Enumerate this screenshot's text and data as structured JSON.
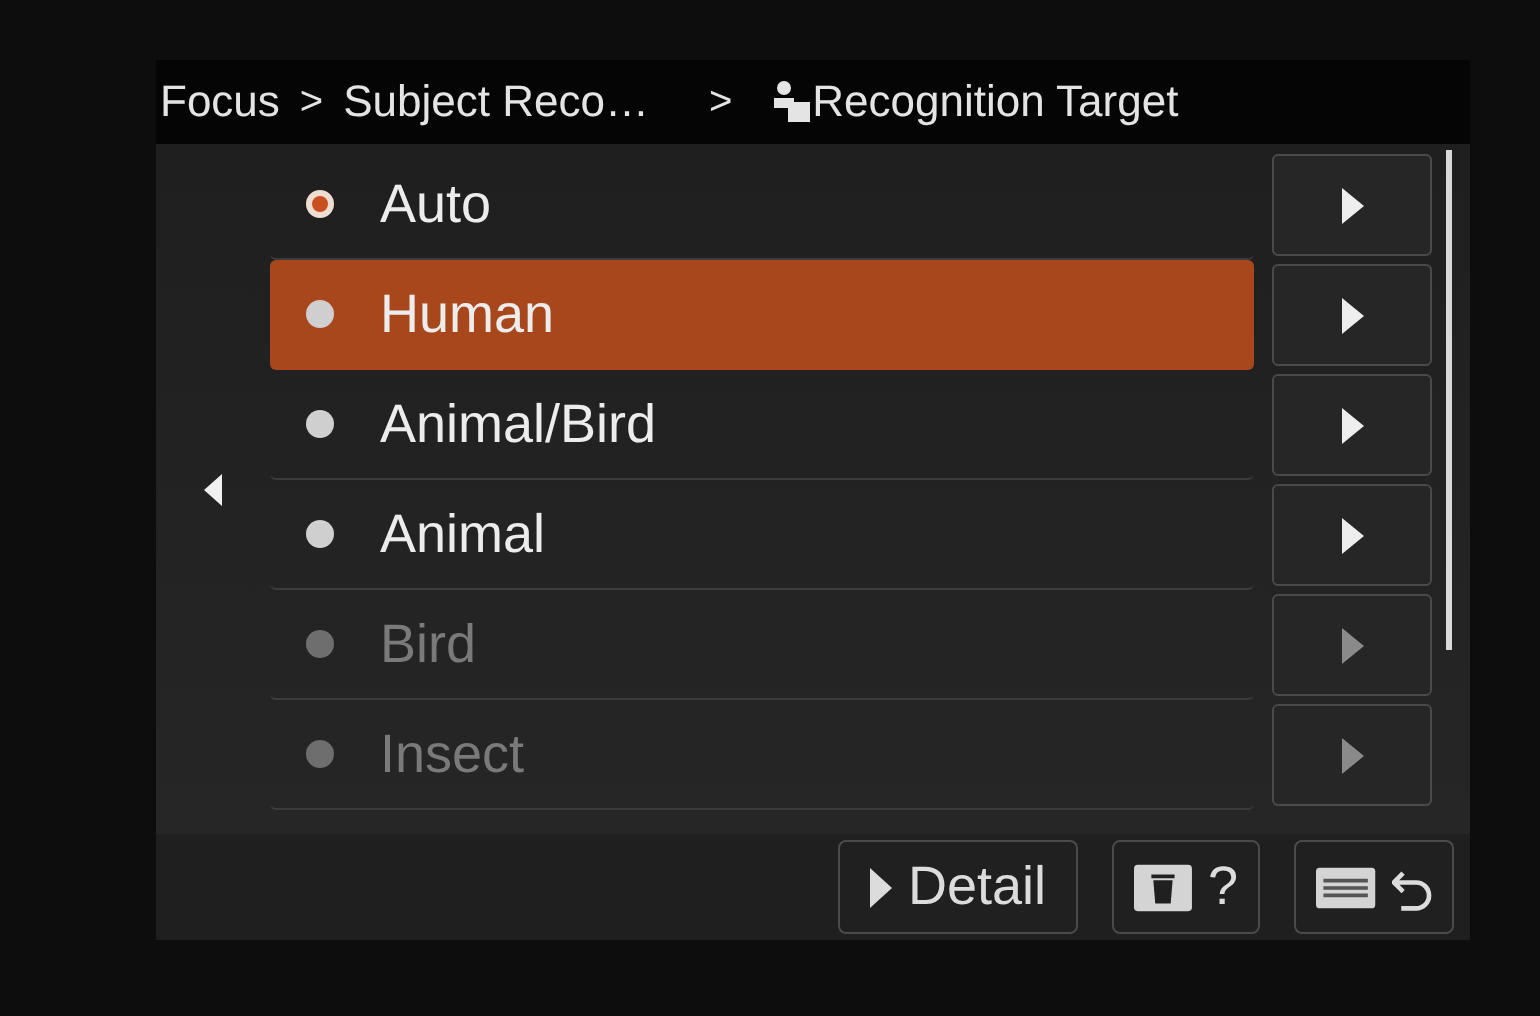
{
  "breadcrumb": [
    {
      "kind": "crumb",
      "text": "Focus"
    },
    {
      "kind": "separator",
      "text": ">"
    },
    {
      "kind": "crumb",
      "text": "Subject Reco…"
    },
    {
      "kind": "separator",
      "text": ">"
    },
    {
      "kind": "current",
      "text": "Recognition Target"
    }
  ],
  "options": [
    {
      "label": "Auto",
      "checked": true,
      "selected": false,
      "disabled": false
    },
    {
      "label": "Human",
      "checked": false,
      "selected": true,
      "disabled": false
    },
    {
      "label": "Animal/Bird",
      "checked": false,
      "selected": false,
      "disabled": false
    },
    {
      "label": "Animal",
      "checked": false,
      "selected": false,
      "disabled": false
    },
    {
      "label": "Bird",
      "checked": false,
      "selected": false,
      "disabled": true
    },
    {
      "label": "Insect",
      "checked": false,
      "selected": false,
      "disabled": true
    }
  ],
  "footer": {
    "detail": "Detail",
    "help": "?"
  }
}
